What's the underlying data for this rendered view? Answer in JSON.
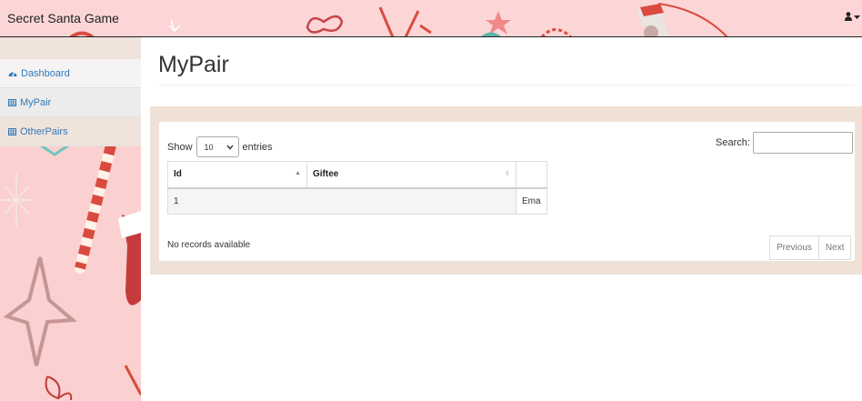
{
  "navbar": {
    "brand": "Secret Santa Game",
    "user_icon": "user-icon",
    "caret_icon": "caret-down-icon"
  },
  "sidebar": {
    "items": [
      {
        "label": "Dashboard",
        "icon": "dashboard-icon"
      },
      {
        "label": "MyPair",
        "icon": "table-icon"
      },
      {
        "label": "OtherPairs",
        "icon": "table-icon"
      }
    ]
  },
  "main": {
    "title": "MyPair",
    "table": {
      "show_label": "Show",
      "length_value": "10",
      "entries_label": "entries",
      "search_label": "Search:",
      "search_value": "",
      "columns": [
        "Id",
        "Giftee"
      ],
      "rows": [
        {
          "id": "1",
          "extra": "Ema"
        }
      ],
      "info": "No records available",
      "prev_label": "Previous",
      "next_label": "Next"
    }
  },
  "colors": {
    "navbar_bg": "#fcd6d6",
    "sidebar_bg": "#fbd0d0",
    "panel_border": "#f0e1d7",
    "link": "#337ab7"
  }
}
